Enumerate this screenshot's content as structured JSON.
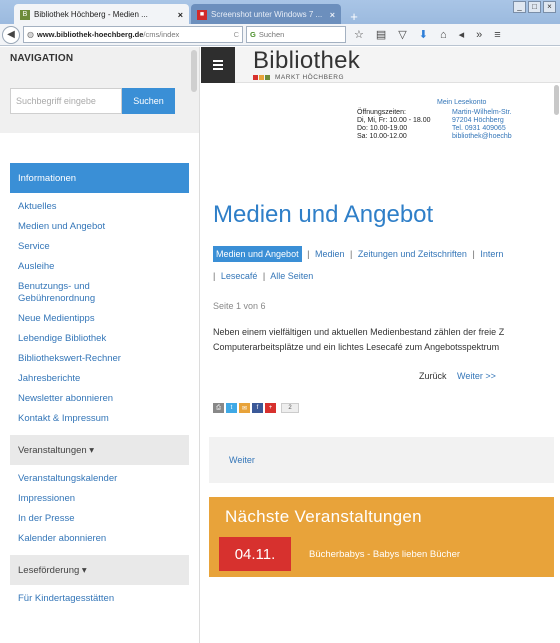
{
  "browser": {
    "tabs": [
      {
        "label": "Bibliothek Höchberg - Medien ...",
        "close": "×"
      },
      {
        "label": "Screenshot unter Windows 7 ...",
        "close": "×"
      }
    ],
    "new_tab": "+",
    "window_controls": [
      "_",
      "□",
      "×"
    ],
    "url_host": "www.bibliothek-hoechberg.de",
    "url_path": "/cms/index",
    "reload": "C",
    "search_placeholder": "Suchen"
  },
  "sidebar": {
    "title": "NAVIGATION",
    "search_placeholder": "Suchbegriff eingebe",
    "search_button": "Suchen",
    "sections": [
      {
        "label": "Informationen",
        "items": [
          "Aktuelles",
          "Medien und Angebot",
          "Service",
          "Ausleihe",
          "Benutzungs- und Gebührenordnung",
          "Neue Medientipps",
          "Lebendige Bibliothek",
          "Bibliothekswert-Rechner",
          "Jahresberichte",
          "Newsletter abonnieren",
          "Kontakt & Impressum"
        ]
      },
      {
        "label": "Veranstaltungen ▾",
        "items": [
          "Veranstaltungskalender",
          "Impressionen",
          "In der Presse",
          "Kalender abonnieren"
        ]
      },
      {
        "label": "Leseförderung ▾",
        "items": [
          "Für Kindertagesstätten"
        ]
      }
    ]
  },
  "header": {
    "logo_title": "Bibliothek",
    "logo_subtitle": "MARKT HÖCHBERG",
    "colors": {
      "sq1": "#d7312e",
      "sq2": "#e8a33a",
      "sq3": "#6d8b3a"
    }
  },
  "contact": {
    "account_link": "Mein Lesekonto",
    "hours_label": "Öffnungszeiten:",
    "hours": [
      "Di, Mi, Fr: 10.00 - 18.00",
      "Do: 10.00-19.00",
      "Sa: 10.00-12.00"
    ],
    "address": [
      "Martin-Wilhelm-Str.",
      "97204 Höchberg",
      "Tel. 0931 409065",
      "bibliothek@hoechb"
    ]
  },
  "main": {
    "page_title": "Medien und Angebot",
    "subnav_active": "Medien und Angebot",
    "subnav": [
      "Medien",
      "Zeitungen und Zeitschriften",
      "Intern"
    ],
    "subnav_row2": [
      "Lesecafé",
      "Alle Seiten"
    ],
    "page_info": "Seite 1 von 6",
    "body_line1": "Neben einem vielfältigen und aktuellen Medienbestand zählen der freie Z",
    "body_line2": "Computerarbeitsplätze und ein lichtes Lesecafé zum Angebotsspektrum",
    "pager_back": "Zurück",
    "pager_next": "Weiter >>",
    "share_count": "2",
    "weiter": "Weiter",
    "events_title": "Nächste Veranstaltungen",
    "event_date": "04.11.",
    "event_name": "Bücherbabys - Babys lieben Bücher"
  }
}
